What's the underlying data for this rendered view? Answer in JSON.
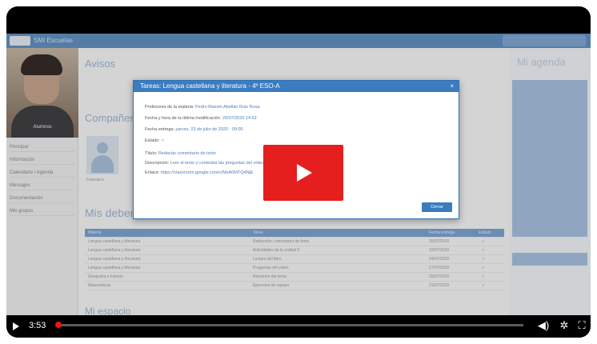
{
  "player": {
    "time": "3:53",
    "progress_fraction": 0.0,
    "icons": {
      "play": "play-icon",
      "volume": "volume-icon",
      "settings": "gear-icon",
      "fullscreen": "fullscreen-icon",
      "big_play": "youtube-play-icon"
    }
  },
  "lms": {
    "brand": "SMI Escuelas",
    "sidebar": {
      "photo_caption": "Alumnos",
      "items": [
        "Principal",
        "Información",
        "Calendario / Agenda",
        "Mensajes",
        "Documentación",
        "Mis grupos"
      ]
    },
    "main": {
      "section_avisos": "Avisos",
      "section_companeros": "Compañeros",
      "companero_name": "Francisco",
      "section_deberes": "Mis deberes",
      "section_espacio": "Mi espacio",
      "table_header": [
        "Materia",
        "Tarea",
        "Fecha entrega",
        "Estado"
      ],
      "table_rows": [
        [
          "Lengua castellana y literatura",
          "Redacción: comentario de texto",
          "20/07/2020",
          "✓"
        ],
        [
          "Lengua castellana y literatura",
          "Actividades de la unidad 5",
          "22/07/2020",
          "✓"
        ],
        [
          "Lengua castellana y literatura",
          "Lectura del libro",
          "24/07/2020",
          "✓"
        ],
        [
          "Lengua castellana y literatura",
          "Preguntas del vídeo",
          "27/07/2020",
          "✓"
        ],
        [
          "Geografía e historia",
          "Resumen del tema",
          "29/07/2020",
          "✓"
        ],
        [
          "Matemáticas",
          "Ejercicios de repaso",
          "31/07/2020",
          "✓"
        ]
      ]
    },
    "agenda": {
      "title": "Mi agenda"
    }
  },
  "modal": {
    "title": "Tareas: Lengua castellana y literatura - 4º ESO-A",
    "close_symbol": "×",
    "fields": [
      {
        "label": "Profesores de la materia:",
        "value": "Pedro Ramón Abellán Ruiz Rosa"
      },
      {
        "label": "Fecha y hora de la última modificación:",
        "value": "20/07/2020 14:52"
      },
      {
        "label": "Fecha entrega:",
        "value": "jueves, 23 de julio de 2020 - 09:00"
      },
      {
        "label": "Estado:",
        "value": "✓"
      },
      {
        "label": "Título:",
        "value": "Redactar comentario de texto"
      },
      {
        "label": "Descripción:",
        "value": "Leer el texto y contestar las preguntas del vídeo"
      },
      {
        "label": "Enlace:",
        "value": "https://classroom.google.com/c/MzA0MTQ4NjE"
      }
    ],
    "close_button": "Cerrar"
  }
}
